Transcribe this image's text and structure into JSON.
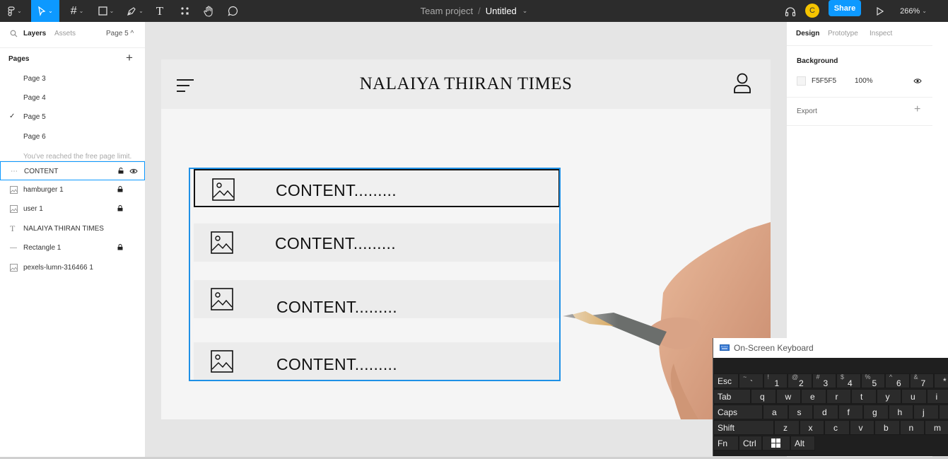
{
  "toolbar": {
    "project": "Team project",
    "separator": "/",
    "file_name": "Untitled",
    "avatar_initial": "C",
    "share_label": "Share",
    "zoom": "266%"
  },
  "left_panel": {
    "tabs": {
      "layers": "Layers",
      "assets": "Assets",
      "page": "Page 5 ^"
    },
    "pages_label": "Pages",
    "pages": [
      {
        "label": "Page 3",
        "current": false
      },
      {
        "label": "Page 4",
        "current": false
      },
      {
        "label": "Page 5",
        "current": true
      },
      {
        "label": "Page 6",
        "current": false
      }
    ],
    "page_limit_note": "You've reached the free page limit.",
    "layers": [
      {
        "label": "CONTENT",
        "icon": "frame-icon",
        "locked": false
      },
      {
        "label": "hamburger 1",
        "icon": "image-icon",
        "locked": true
      },
      {
        "label": "user 1",
        "icon": "image-icon",
        "locked": true
      },
      {
        "label": "NALAIYA THIRAN TIMES",
        "icon": "text-icon",
        "locked": false
      },
      {
        "label": "Rectangle 1",
        "icon": "rectangle-icon",
        "locked": true
      },
      {
        "label": "pexels-lumn-316466 1",
        "icon": "image-icon",
        "locked": false
      }
    ]
  },
  "canvas": {
    "masthead": "NALAIYA THIRAN TIMES",
    "content_rows": [
      "CONTENT.........",
      "CONTENT.........",
      "CONTENT.........",
      "CONTENT........."
    ]
  },
  "right_panel": {
    "tabs": {
      "design": "Design",
      "prototype": "Prototype",
      "inspect": "Inspect"
    },
    "background_label": "Background",
    "bg_hex": "F5F5F5",
    "bg_opacity": "100%",
    "export_label": "Export",
    "plus": "+"
  },
  "osk": {
    "title": "On-Screen Keyboard",
    "rows": [
      [
        "Esc",
        "~ `",
        "! 1",
        "@ 2",
        "# 3",
        "$ 4",
        "% 5",
        "^ 6",
        "& 7",
        "*"
      ],
      [
        "Tab",
        "q",
        "w",
        "e",
        "r",
        "t",
        "y",
        "u",
        "i"
      ],
      [
        "Caps",
        "a",
        "s",
        "d",
        "f",
        "g",
        "h",
        "j",
        "k"
      ],
      [
        "Shift",
        "z",
        "x",
        "c",
        "v",
        "b",
        "n",
        "m"
      ],
      [
        "Fn",
        "Ctrl",
        "",
        "Alt"
      ]
    ]
  },
  "colors": {
    "accent": "#0d99ff",
    "toolbar_bg": "#2c2c2c",
    "frame_bg": "#f5f5f5",
    "avatar": "#f5c400"
  }
}
